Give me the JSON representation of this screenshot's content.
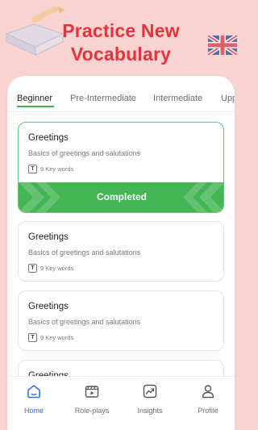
{
  "headline": {
    "line1": "Practice New",
    "line2": "Vocabulary"
  },
  "tabs": [
    {
      "label": "Beginner",
      "active": true
    },
    {
      "label": "Pre-Intermediate",
      "active": false
    },
    {
      "label": "Intermediate",
      "active": false
    },
    {
      "label": "Upp",
      "active": false
    }
  ],
  "courses": [
    {
      "title": "Greetings",
      "subtitle": "Basics of greetings and salutations",
      "meta_icon": "T",
      "meta": "9 Key words",
      "status": "Completed"
    },
    {
      "title": "Greetings",
      "subtitle": "Basics of greetings and salutations",
      "meta_icon": "T",
      "meta": "9 Key words"
    },
    {
      "title": "Greetings",
      "subtitle": "Basics of greetings and salutations",
      "meta_icon": "T",
      "meta": "9 Key words"
    },
    {
      "title": "Greetings"
    }
  ],
  "nav": [
    {
      "label": "Home",
      "icon": "home-icon",
      "active": true
    },
    {
      "label": "Role-plays",
      "icon": "roleplay-icon",
      "active": false
    },
    {
      "label": "Insights",
      "icon": "insights-icon",
      "active": false
    },
    {
      "label": "Profile",
      "icon": "profile-icon",
      "active": false
    }
  ],
  "colors": {
    "background": "#f9d3cf",
    "headline": "#e6333f",
    "accent_green": "#44b553",
    "nav_active": "#2f6fe0"
  }
}
